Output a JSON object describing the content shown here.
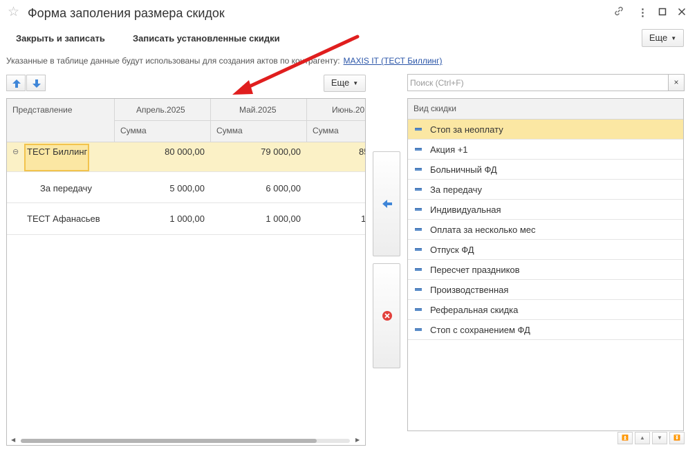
{
  "window": {
    "title": "Форма заполения размера скидок",
    "controls": [
      "link-icon",
      "more-icon",
      "minimize-icon",
      "maximize-icon",
      "close-icon"
    ]
  },
  "toolbar": {
    "close_save_label": "Закрыть и записать",
    "write_discounts_label": "Записать установленные скидки",
    "more_label": "Еще"
  },
  "note": {
    "text": "Указанные в таблице данные будут использованы для создания актов по контрагенту:",
    "link": "MAXIS IT (ТЕСТ Биллинг)"
  },
  "grid": {
    "more_label": "Еще",
    "col_presentation": "Представление",
    "periods": [
      "Апрель.2025",
      "Май.2025",
      "Июнь.20"
    ],
    "sub_header": "Сумма",
    "rows": [
      {
        "label": "ТЕСТ Биллинг",
        "values": [
          "80 000,00",
          "79 000,00",
          "85"
        ],
        "selected": true
      },
      {
        "label": "За передачу",
        "values": [
          "5 000,00",
          "6 000,00",
          ""
        ],
        "selected": false
      },
      {
        "label": "ТЕСТ Афанасьев",
        "values": [
          "1 000,00",
          "1 000,00",
          "1"
        ],
        "selected": false
      }
    ]
  },
  "search": {
    "placeholder": "Поиск (Ctrl+F)",
    "clear_label": "×"
  },
  "discounts": {
    "header": "Вид скидки",
    "items": [
      "Стоп за неоплату",
      "Акция +1",
      "Больничный ФД",
      "За передачу",
      "Индивидуальная",
      "Оплата за несколько мес",
      "Отпуск ФД",
      "Пересчет праздников",
      "Производственная",
      "Реферальная скидка",
      "Стоп с сохранением ФД"
    ],
    "selected_index": 0
  },
  "colors": {
    "selection": "#fbe7a3",
    "link": "#2a55a8",
    "annotation_arrow": "#e01e1e"
  }
}
